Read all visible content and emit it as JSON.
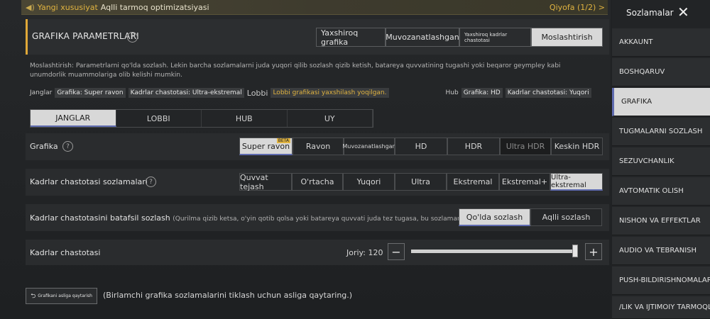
{
  "banner": {
    "new_tag": "Yangi xususiyat",
    "message": "Aqlli tarmoq optimizatsiyasi",
    "page": "Qiyofa (1/2) >"
  },
  "header": {
    "title": "GRAFIKA PARAMETRLARI",
    "presets": [
      {
        "label": "Yaxshiroq grafika",
        "active": false
      },
      {
        "label": "Muvozanatlashgan",
        "active": false
      },
      {
        "label": "Yaxshiroq kadrlar chastotasi",
        "active": false
      },
      {
        "label": "Moslashtirish",
        "active": true
      }
    ]
  },
  "description": "Moslashtirish: Parametrlarni qo'lda sozlash. Lekin barcha sozlamalarni juda yuqori qilib sozlash qizib ketish, batareya quvvatining tugashi yoki beqaror geympley kabi unumdorlik muammolariga olib kelishi mumkin.",
  "status": {
    "janglar_label": "Janglar",
    "janglar_grafika": "Grafika: Super ravon",
    "janglar_kadr": "Kadrlar chastotasi: Ultra-ekstremal",
    "lobbi_label": "Lobbi",
    "lobbi_note": "Lobbi grafikasi yaxshilash yoqilgan.",
    "hub_label": "Hub",
    "hub_grafika": "Grafika: HD",
    "hub_kadr": "Kadrlar chastotasi: Yuqori"
  },
  "tabs": [
    {
      "label": "JANGLAR",
      "active": true
    },
    {
      "label": "LOBBI",
      "active": false
    },
    {
      "label": "HUB",
      "active": false
    },
    {
      "label": "UY",
      "active": false
    }
  ],
  "grafika": {
    "label": "Grafika",
    "beta": "BETA",
    "options": [
      "Super ravon",
      "Ravon",
      "Muvozanatlashgan",
      "HD",
      "HDR",
      "Ultra HDR",
      "Keskin HDR"
    ]
  },
  "kadr_settings": {
    "label": "Kadrlar chastotasi sozlamalari",
    "options": [
      "Quvvat tejash",
      "O'rtacha",
      "Yuqori",
      "Ultra",
      "Ekstremal",
      "Ekstremal+",
      "Ultra-ekstremal"
    ]
  },
  "kadr_detail": {
    "label": "Kadrlar chastotasini batafsil sozlash",
    "hint": "(Qurilma qizib ketsa, o'yin qotib qolsa yoki batareya quvvati juda tez tugasa, bu sozlamani pasayt",
    "options": [
      "Qo'lda sozlash",
      "Aqlli sozlash"
    ]
  },
  "kadr_rate": {
    "label": "Kadrlar chastotasi",
    "current": "Joriy: 120",
    "minus": "−",
    "plus": "+",
    "level": 1.0
  },
  "reset": {
    "button": "Grafikani asliga qaytarish",
    "note": "(Birlamchi grafika sozlamalarini tiklash uchun asliga qaytaring.)"
  },
  "sidebar": {
    "title": "Sozlamalar",
    "items": [
      {
        "label": "AKKAUNT",
        "active": false
      },
      {
        "label": "BOSHQARUV",
        "active": false
      },
      {
        "label": "GRAFIKA",
        "active": true
      },
      {
        "label": "TUGMALARNI SOZLASH",
        "active": false
      },
      {
        "label": "SEZUVCHANLIK",
        "active": false
      },
      {
        "label": "AVTOMATIK OLISH",
        "active": false
      },
      {
        "label": "NISHON VA EFFEKTLAR",
        "active": false
      },
      {
        "label": "AUDIO VA TEBRANISH",
        "active": false
      },
      {
        "label": "PUSH-BILDIRISHNOMALAR",
        "active": false
      },
      {
        "label": "/LIK VA IJTIMOIY TARMOQLA",
        "active": false
      }
    ]
  },
  "colors": {
    "accent": "#e0a838",
    "active_bg": "#d8d8d8",
    "active_line": "#5f6bb0",
    "gold": "#e0b340"
  }
}
